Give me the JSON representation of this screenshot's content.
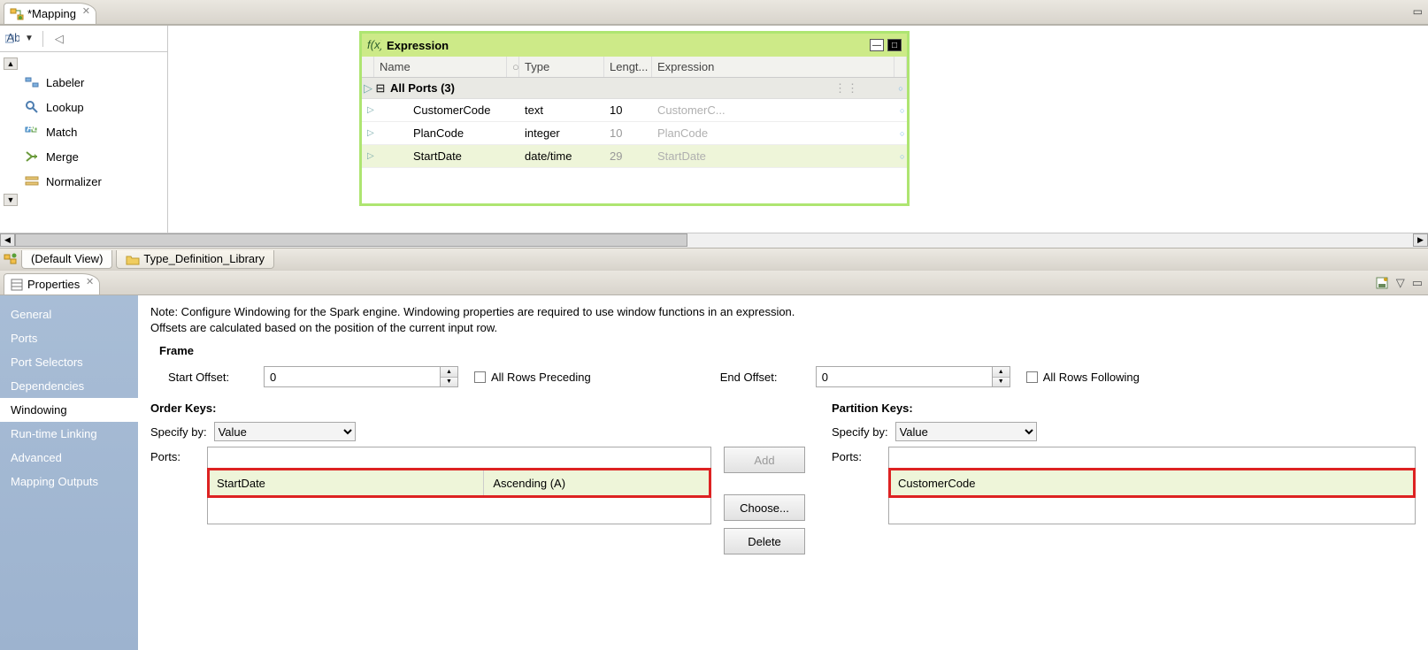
{
  "editor": {
    "tab_title": "*Mapping",
    "palette": {
      "items": [
        {
          "label": "Labeler"
        },
        {
          "label": "Lookup"
        },
        {
          "label": "Match"
        },
        {
          "label": "Merge"
        },
        {
          "label": "Normalizer"
        }
      ]
    },
    "expression": {
      "title": "Expression",
      "columns": {
        "name": "Name",
        "type": "Type",
        "length": "Lengt...",
        "expr": "Expression"
      },
      "all_ports_label": "All Ports (3)",
      "ports": [
        {
          "name": "CustomerCode",
          "type": "text",
          "length": "10",
          "length_dark": true,
          "expr": "CustomerC..."
        },
        {
          "name": "PlanCode",
          "type": "integer",
          "length": "10",
          "length_dark": false,
          "expr": "PlanCode"
        },
        {
          "name": "StartDate",
          "type": "date/time",
          "length": "29",
          "length_dark": false,
          "expr": "StartDate",
          "selected": true
        }
      ]
    },
    "footer_tabs": {
      "default_view": "(Default View)",
      "lib": "Type_Definition_Library"
    }
  },
  "properties": {
    "tab_title": "Properties",
    "side_items": [
      {
        "label": "General"
      },
      {
        "label": "Ports"
      },
      {
        "label": "Port Selectors"
      },
      {
        "label": "Dependencies"
      },
      {
        "label": "Windowing",
        "active": true
      },
      {
        "label": "Run-time Linking"
      },
      {
        "label": "Advanced"
      },
      {
        "label": "Mapping Outputs"
      }
    ],
    "note_line1": "Note: Configure Windowing for the Spark engine. Windowing properties are required to use window functions in an expression.",
    "note_line2": "Offsets are calculated based on the position of the current input row.",
    "frame_label": "Frame",
    "start_offset_label": "Start Offset:",
    "start_offset_value": "0",
    "all_rows_preceding": "All Rows Preceding",
    "end_offset_label": "End Offset:",
    "end_offset_value": "0",
    "all_rows_following": "All Rows Following",
    "order_keys": {
      "title": "Order Keys:",
      "specify_label": "Specify by:",
      "specify_value": "Value",
      "ports_label": "Ports:",
      "row": {
        "port": "StartDate",
        "dir": "Ascending (A)"
      }
    },
    "partition_keys": {
      "title": "Partition Keys:",
      "specify_label": "Specify by:",
      "specify_value": "Value",
      "ports_label": "Ports:",
      "row": {
        "port": "CustomerCode"
      }
    },
    "buttons": {
      "add": "Add",
      "choose": "Choose...",
      "delete": "Delete"
    }
  }
}
